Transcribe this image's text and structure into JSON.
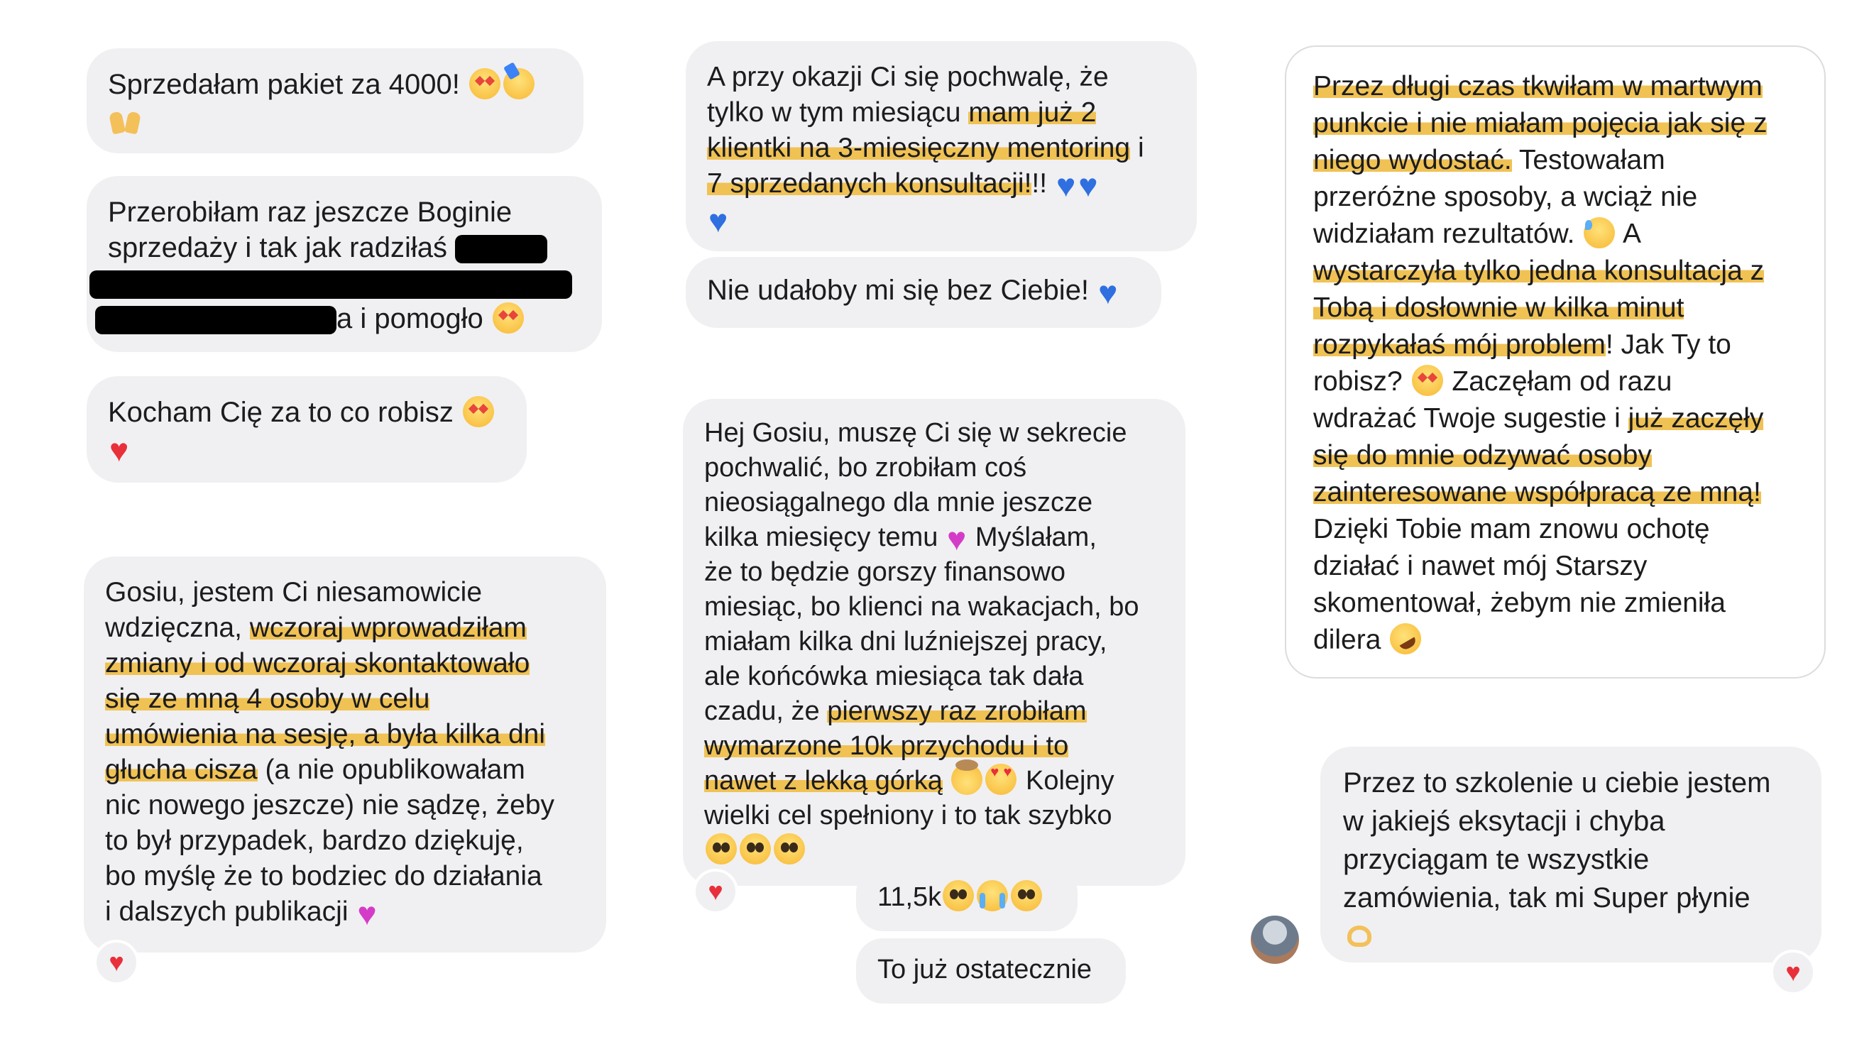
{
  "bubbles": {
    "b1": [
      "Sprzedałam pakiet za 4000!"
    ],
    "b2": [
      "Przerobiłam raz jeszcze Boginie",
      "sprzedaży i tak jak radziłaś",
      "a i pomogło"
    ],
    "b3": [
      "Kocham Cię za to co robisz"
    ],
    "b4": [
      "Gosiu, jestem Ci niesamowicie",
      "wdzięczna,",
      "wczoraj wprowadziłam",
      "zmiany i od wczoraj skontaktowało",
      "się ze mną 4 osoby w celu",
      "umówienia na sesję, a była kilka dni",
      "głucha cisza",
      "(a nie opublikowałam",
      "nic nowego jeszcze) nie sądzę, żeby",
      "to był przypadek, bardzo dziękuję,",
      "bo myślę że to bodziec do działania",
      "i dalszych publikacji"
    ],
    "b5": [
      "A przy okazji Ci się pochwalę, że",
      "tylko w tym miesiącu",
      "mam już 2",
      "klientki na 3-miesięczny mentoring",
      "i",
      "7 sprzedanych konsultacji!",
      "!!"
    ],
    "b6": [
      "Nie udałoby mi się bez Ciebie!"
    ],
    "b7": [
      "Hej Gosiu, muszę Ci się w sekrecie",
      "pochwalić, bo zrobiłam coś",
      "nieosiągalnego dla mnie jeszcze",
      "kilka miesięcy temu",
      "Myślałam,",
      "że to będzie gorszy finansowo",
      "miesiąc, bo klienci na wakacjach, bo",
      "miałam kilka dni luźniejszej pracy,",
      "ale końcówka miesiąca tak dała",
      "czadu, że",
      "pierwszy raz zrobiłam",
      "wymarzone 10k przychodu i to",
      "nawet z lekką górką",
      "Kolejny",
      "wielki cel spełniony i to tak szybko"
    ],
    "b8": [
      "11,5k"
    ],
    "b9": [
      "To już ostatecznie"
    ],
    "b10": [
      "Przez długi czas tkwiłam w martwym",
      "punkcie i nie miałam pojęcia jak się z",
      "niego wydostać.",
      "Testowałam",
      "przeróżne sposoby, a wciąż nie",
      "widziałam rezultatów.",
      "A",
      "wystarczyła tylko jedna konsultacja z",
      "Tobą i dosłownie w kilka minut",
      "rozpykałaś mój problem",
      "! Jak Ty to",
      "robisz?",
      "Zaczęłam od razu",
      "wdrażać Twoje sugestie i",
      "już zaczęły",
      "się do mnie odzywać osoby",
      "zainteresowane współpracą ze mną!",
      "Dzięki Tobie mam znowu ochotę",
      "działać i nawet mój Starszy",
      "skomentował, żebym nie zmieniła",
      "dilera"
    ],
    "b11": [
      "Przez to szkolenie u ciebie jestem",
      "w jakiejś eksytacji i chyba",
      "przyciągam te wszystkie",
      "zamówienia, tak mi Super płynie"
    ]
  },
  "reactions": {
    "heart": "♥"
  },
  "icons": {
    "heart": "♥",
    "reaction_heart": "heart-icon",
    "avatar": "avatar"
  },
  "colors": {
    "highlight": "#f0c254",
    "bubble": "#f0f0f2",
    "heart_red": "#e8303a",
    "heart_blue": "#2f6fe0",
    "heart_pink": "#d43cc8"
  }
}
